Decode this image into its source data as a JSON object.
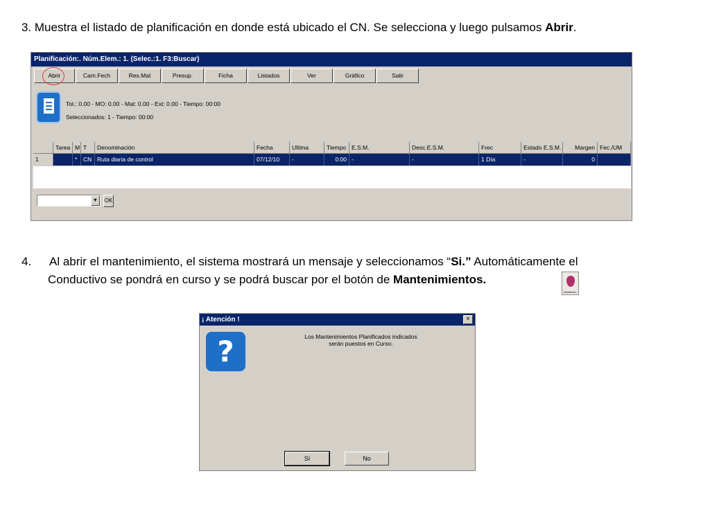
{
  "step3": {
    "text": "3. Muestra el listado de planificación en donde está ubicado el CN. Se selecciona y luego pulsamos ",
    "bold": "Abrir",
    "end": "."
  },
  "step4": {
    "num": "4.",
    "line1_a": "Al abrir el mantenimiento, el sistema mostrará un mensaje y  seleccionamos  “",
    "line1_bold": "Si.”",
    "line1_b": " Automáticamente el",
    "line2_a": "Conductivo se pondrá en curso y se podrá buscar por el botón de   ",
    "line2_bold": "Mantenimientos."
  },
  "planning_window": {
    "title": "Planificación:. Núm.Elem.: 1. (Selec.:1. F3:Buscar)",
    "toolbar": [
      "Abrir",
      "Cam.Fech",
      "Res.Mat",
      "Presup.",
      "Ficha",
      "Listados",
      "Ver",
      "Gráfico",
      "Salir"
    ],
    "info_line1": "Tot.: 0.00 - MO: 0.00 - Mat: 0.00 - Ext: 0.00 - Tiempo: 00:00",
    "info_line2": "Seleccionados: 1 - Tiempo: 00:00",
    "icon": "document-list-icon",
    "columns": [
      "",
      "Tarea",
      "M",
      "T",
      "Denominación",
      "Fecha",
      "Ultima",
      "Tiempo",
      "E.S.M.",
      "Desc.E.S.M.",
      "Frec",
      "Estado E.S.M.",
      "Margen",
      "Fec./UM"
    ],
    "rows": [
      [
        "1",
        "",
        "*",
        "CN",
        "Ruta diaria de control",
        "07/12/10",
        "-",
        "0:00",
        "-",
        "-",
        "1 Día",
        "-",
        "0",
        ""
      ]
    ],
    "ok_label": "OK"
  },
  "mantenimientos_icon": {
    "label": "Mantenim.",
    "icon": "mantenimientos-drop-icon"
  },
  "dialog": {
    "title": "¡ Atención !",
    "icon": "question-icon",
    "message_line1": "Los Mantenimientos Planificados indicados",
    "message_line2": "serán puestos en Curso.",
    "yes": "Sí",
    "no": "No",
    "close": "×"
  },
  "colors": {
    "titlebar": "#0a246a",
    "window": "#d4d0c8",
    "selection": "#0a246a",
    "highlight_circle": "#dd3333",
    "icon_blue": "#1d6fc8"
  }
}
